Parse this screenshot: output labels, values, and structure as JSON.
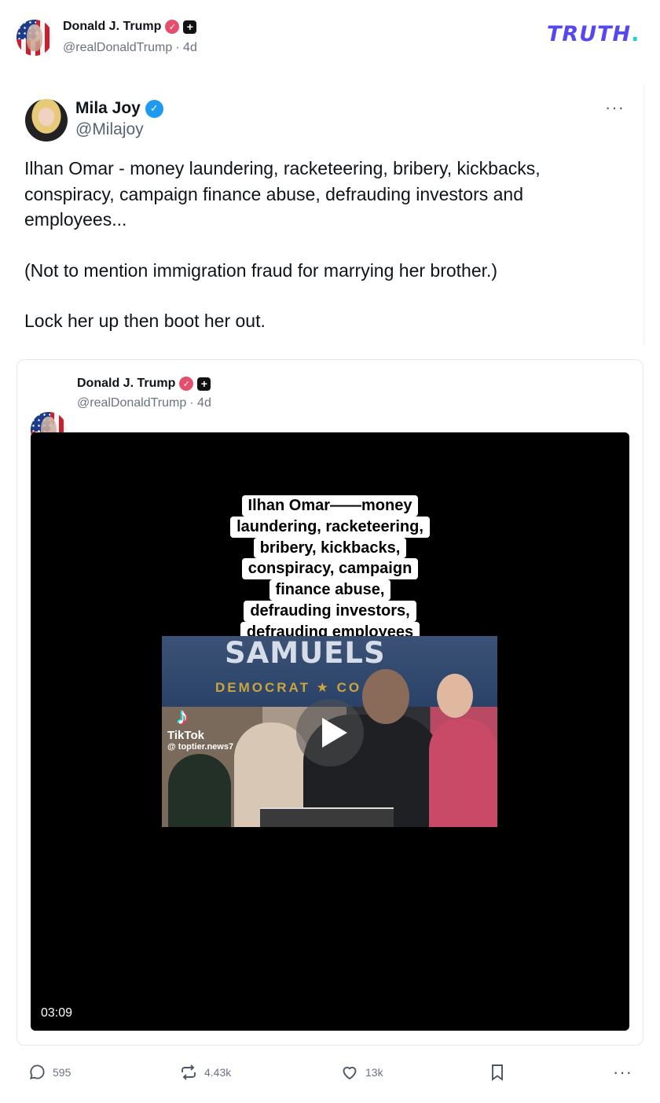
{
  "header": {
    "author_name": "Donald J. Trump",
    "author_handle": "@realDonaldTrump",
    "time": "· 4d",
    "verified_symbol": "✓",
    "plus_symbol": "+",
    "logo_text": "TRUTH",
    "logo_dot": "."
  },
  "embedded_post": {
    "name": "Mila Joy",
    "handle": "@Milajoy",
    "verified_symbol": "✓",
    "more": "···",
    "paragraphs": [
      "Ilhan Omar - money laundering, racketeering, bribery, kickbacks, conspiracy, campaign finance abuse, defrauding investors and employees...",
      "(Not to mention immigration fraud for marrying her brother.)",
      "Lock her up then boot her out."
    ]
  },
  "quoted_post": {
    "author_name": "Donald J. Trump",
    "author_handle": "@realDonaldTrump",
    "time": "· 4d",
    "verified_symbol": "✓",
    "plus_symbol": "+",
    "video": {
      "caption_lines": [
        "Ilhan Omar——money",
        "laundering, racketeering,",
        "bribery, kickbacks,",
        "conspiracy, campaign",
        "finance abuse,",
        "defrauding investors,",
        "defrauding employees"
      ],
      "banner_text": "SAMUELS",
      "banner_sub": "DEMOCRAT ★ CO",
      "tiktok_note": "♪",
      "tiktok_word": "TikTok",
      "tiktok_handle": "@ toptier.news7",
      "duration": "03:09"
    }
  },
  "actions": {
    "replies": "595",
    "retruths": "4.43k",
    "likes": "13k",
    "more": "···"
  }
}
